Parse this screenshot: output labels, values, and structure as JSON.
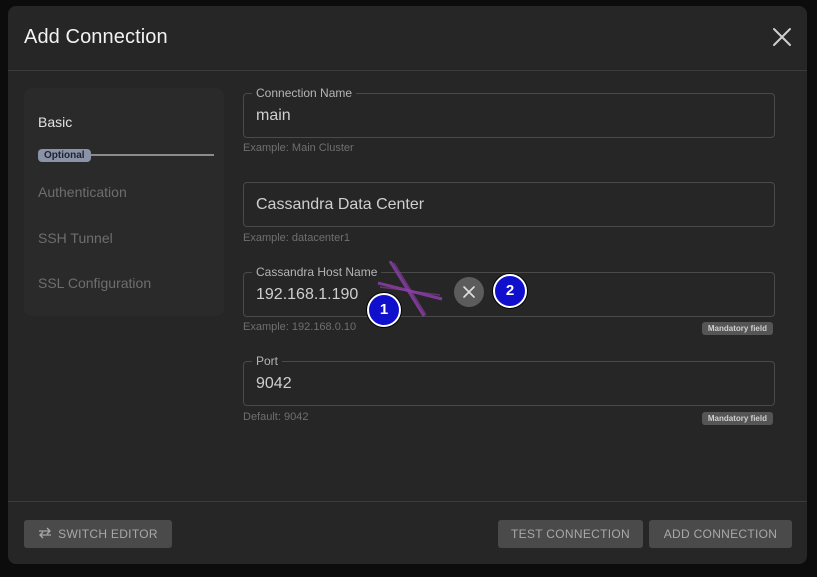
{
  "dialog": {
    "title": "Add Connection",
    "close_icon": "close-icon"
  },
  "sidebar": {
    "steps": [
      {
        "label": "Basic",
        "state": "active"
      },
      {
        "label": "Authentication",
        "state": "inactive"
      },
      {
        "label": "SSH Tunnel",
        "state": "inactive"
      },
      {
        "label": "SSL Configuration",
        "state": "inactive"
      }
    ],
    "optional_badge": "Optional"
  },
  "form": {
    "connection_name": {
      "label": "Connection Name",
      "value": "main",
      "helper": "Example: Main Cluster"
    },
    "data_center": {
      "placeholder": "Cassandra Data Center",
      "helper": "Example: datacenter1"
    },
    "host_name": {
      "label": "Cassandra Host Name",
      "value": "192.168.1.190",
      "helper": "Example: 192.168.0.10",
      "badge": "Mandatory field"
    },
    "port": {
      "label": "Port",
      "value": "9042",
      "helper": "Default: 9042",
      "badge": "Mandatory field"
    }
  },
  "annotations": {
    "marker_1": "1",
    "marker_2": "2"
  },
  "footer": {
    "switch_editor": "SWITCH EDITOR",
    "test_connection": "TEST CONNECTION",
    "add_connection": "ADD CONNECTION"
  },
  "colors": {
    "background": "#0c0c0c",
    "dialog": "#262626",
    "marker": "#1010cc",
    "cursor_mark": "#8a3fa6"
  }
}
